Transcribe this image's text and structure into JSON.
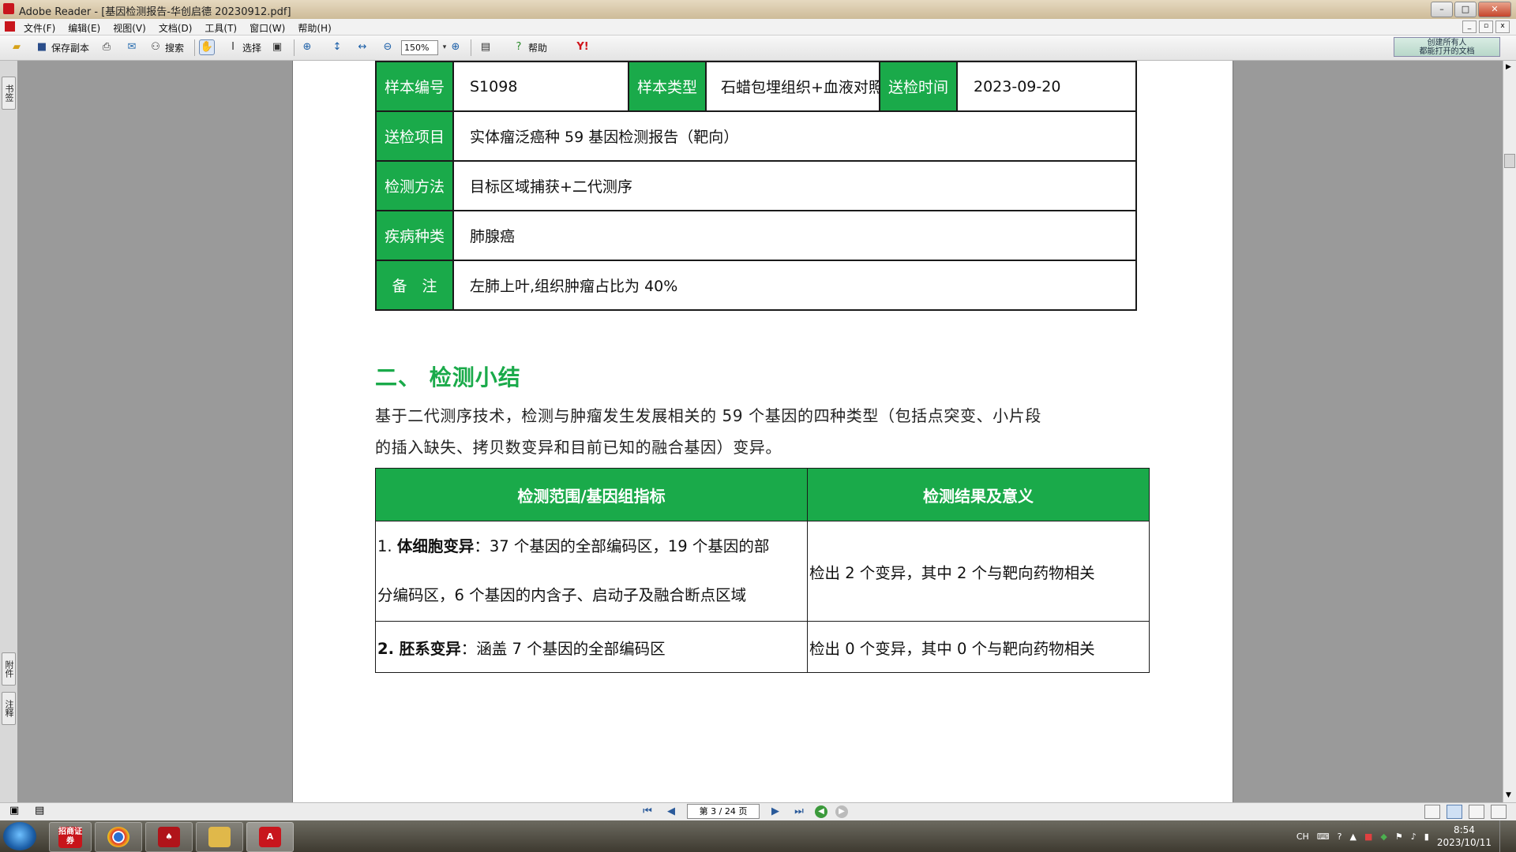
{
  "window": {
    "title": "Adobe Reader - [基因检测报告-华创启德 20230912.pdf]",
    "minimize": "–",
    "maximize": "□",
    "close": "✕"
  },
  "menu": {
    "items": [
      "文件(F)",
      "编辑(E)",
      "视图(V)",
      "文档(D)",
      "工具(T)",
      "窗口(W)",
      "帮助(H)"
    ]
  },
  "toolbar": {
    "save_copy": "保存副本",
    "search": "搜索",
    "select": "选择",
    "zoom": "150%",
    "help": "帮助",
    "notice_line1": "创建所有人",
    "notice_line2": "都能打开的文档"
  },
  "side_tabs": {
    "top": "书签",
    "attach": "附件",
    "comments": "注释"
  },
  "report": {
    "sample_id_label": "样本编号",
    "sample_id": "S1098",
    "sample_type_label": "样本类型",
    "sample_type": "石蜡包埋组织+血液对照",
    "sent_time_label": "送检时间",
    "sent_time": "2023-09-20",
    "project_label": "送检项目",
    "project": "实体瘤泛癌种 59 基因检测报告（靶向）",
    "method_label": "检测方法",
    "method": "目标区域捕获+二代测序",
    "disease_label": "疾病种类",
    "disease": "肺腺癌",
    "remark_label": "备　注",
    "remark": "左肺上叶,组织肿瘤占比为 40%",
    "section_title": "二、 检测小结",
    "summary_line1": "基于二代测序技术，检测与肿瘤发生发展相关的 59 个基因的四种类型（包括点突变、小片段",
    "summary_line2": "的插入缺失、拷贝数变异和目前已知的融合基因）变异。",
    "col1_header": "检测范围/基因组指标",
    "col2_header": "检测结果及意义",
    "row1_prefix": "1. ",
    "row1_bold": "体细胞变异",
    "row1_text_a": "：37 个基因的全部编码区，19 个基因的部",
    "row1_text_b": "分编码区，6 个基因的内含子、启动子及融合断点区域",
    "row1_result": "检出 2 个变异，其中 2 个与靶向药物相关",
    "row2_bold": "2. 胚系变异",
    "row2_text": "：涵盖 7 个基因的全部编码区",
    "row2_result": "检出 0 个变异，其中 0 个与靶向药物相关"
  },
  "status": {
    "page_indicator": "第 3 / 24 页"
  },
  "taskbar": {
    "app1": "招商证券",
    "clock_time": "8:54",
    "clock_date": "2023/10/11",
    "ime": "CH"
  },
  "colors": {
    "accent_green": "#1aaa4a"
  }
}
